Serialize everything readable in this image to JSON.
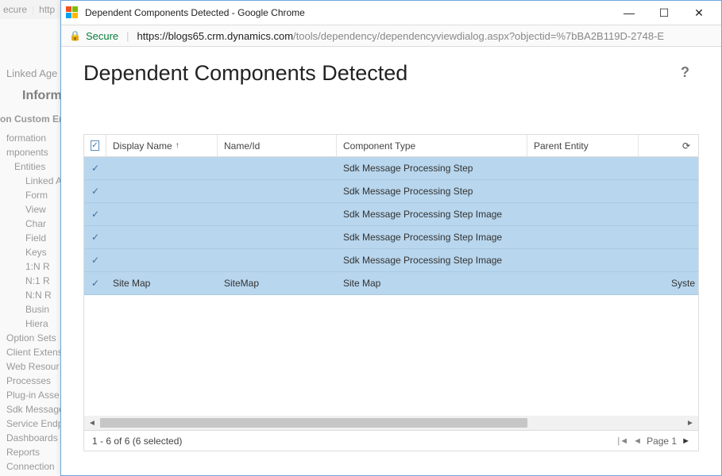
{
  "bg": {
    "topbar_left": "ecure",
    "topbar_http": "http",
    "linked_age": "Linked Age",
    "inform": "Inform",
    "custom_ent": "on Custom Ent",
    "tree": {
      "formation": "formation",
      "mponents": "mponents",
      "entities": "Entities",
      "linked_a": "Linked A",
      "form": "Form",
      "view": "View",
      "char": "Char",
      "field": "Field",
      "keys": "Keys",
      "n1_1": "1:N R",
      "n1_2": "N:1 R",
      "nn": "N:N R",
      "busin": "Busin",
      "hiera": "Hiera",
      "option_sets": "Option Sets",
      "client_extens": "Client Extens",
      "web_resour": "Web Resour",
      "processes": "Processes",
      "plugin_asse": "Plug-in Asse",
      "sdk_message": "Sdk Message",
      "service_endp": "Service Endp",
      "dashboards": "Dashboards",
      "reports": "Reports",
      "connection": "Connection"
    }
  },
  "window": {
    "title": "Dependent Components Detected - Google Chrome"
  },
  "address": {
    "secure": "Secure",
    "url_host": "https://blogs65.crm.dynamics.com",
    "url_path": "/tools/dependency/dependencyviewdialog.aspx?objectid=%7bBA2B119D-2748-E"
  },
  "dialog": {
    "title": "Dependent Components Detected",
    "help": "?"
  },
  "grid": {
    "headers": {
      "display_name": "Display Name",
      "name_id": "Name/Id",
      "component_type": "Component Type",
      "parent_entity": "Parent Entity"
    },
    "rows": [
      {
        "display": "",
        "name": "",
        "type": "Sdk Message Processing Step",
        "parent": "",
        "managed": ""
      },
      {
        "display": "",
        "name": "",
        "type": "Sdk Message Processing Step",
        "parent": "",
        "managed": ""
      },
      {
        "display": "",
        "name": "",
        "type": "Sdk Message Processing Step Image",
        "parent": "",
        "managed": ""
      },
      {
        "display": "",
        "name": "",
        "type": "Sdk Message Processing Step Image",
        "parent": "",
        "managed": ""
      },
      {
        "display": "",
        "name": "",
        "type": "Sdk Message Processing Step Image",
        "parent": "",
        "managed": ""
      },
      {
        "display": "Site Map",
        "name": "SiteMap",
        "type": "Site Map",
        "parent": "",
        "managed": "Syste"
      }
    ],
    "footer_status": "1 - 6 of 6 (6 selected)",
    "page_label": "Page 1"
  }
}
